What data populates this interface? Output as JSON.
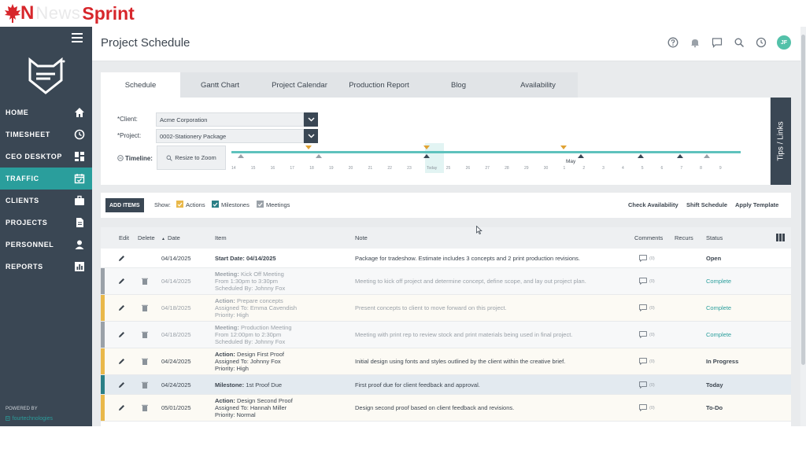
{
  "brand": {
    "n": "N",
    "news": "News",
    "sprint": "Sprint"
  },
  "sidebar": {
    "items": [
      {
        "label": "HOME",
        "icon": "home-icon"
      },
      {
        "label": "TIMESHEET",
        "icon": "clock-icon"
      },
      {
        "label": "CEO DESKTOP",
        "icon": "dashboard-icon"
      },
      {
        "label": "TRAFFIC",
        "icon": "calendar-check-icon",
        "active": true
      },
      {
        "label": "CLIENTS",
        "icon": "briefcase-icon"
      },
      {
        "label": "PROJECTS",
        "icon": "document-icon"
      },
      {
        "label": "PERSONNEL",
        "icon": "person-icon"
      },
      {
        "label": "REPORTS",
        "icon": "bar-chart-icon"
      }
    ],
    "powered_by": "POWERED BY",
    "powered_brand": "fourtechnologies"
  },
  "header": {
    "title": "Project Schedule",
    "avatar_initials": "JF"
  },
  "tabs": [
    "Schedule",
    "Gantt Chart",
    "Project Calendar",
    "Production Report",
    "Blog",
    "Availability"
  ],
  "filters": {
    "client_label": "*Client:",
    "client_value": "Acme Corporation",
    "project_label": "*Project:",
    "project_value": "0002-Stationery Package",
    "timeline_label": "Timeline:",
    "resize_label": "Resize to Zoom",
    "month_label": "May",
    "ticks": [
      "14",
      "15",
      "16",
      "17",
      "18",
      "19",
      "20",
      "21",
      "22",
      "23",
      "Today",
      "25",
      "26",
      "27",
      "28",
      "29",
      "30",
      "1",
      "2",
      "3",
      "4",
      "5",
      "6",
      "7",
      "8",
      "9"
    ],
    "tips_label": "Tips / Links"
  },
  "actionbar": {
    "add_items": "ADD ITEMS",
    "show_label": "Show:",
    "actions": "Actions",
    "milestones": "Milestones",
    "meetings": "Meetings",
    "check_availability": "Check Availability",
    "shift_schedule": "Shift Schedule",
    "apply_template": "Apply Template"
  },
  "table": {
    "headers": {
      "edit": "Edit",
      "delete": "Delete",
      "date": "Date",
      "item": "Item",
      "note": "Note",
      "comments": "Comments",
      "recurs": "Recurs",
      "status": "Status"
    },
    "rows": [
      {
        "date": "04/14/2025",
        "item_title": "Start Date: 04/14/2025",
        "item_lines": [],
        "note": "Package for tradeshow. Estimate includes 3 concepts and 2 print production revisions.",
        "comments": "(0)",
        "status": "Open",
        "stripe": "",
        "muted": false,
        "status_class": "bold",
        "title_bold": true,
        "title_prefix": "",
        "delete": false
      },
      {
        "date": "04/14/2025",
        "title_prefix": "Meeting:",
        "item_title": "Kick Off Meeting",
        "item_lines": [
          "From 1:30pm to 3:30pm",
          "Scheduled By: Johnny Fox"
        ],
        "note": "Meeting to kick off project and determine concept, define scope, and lay out project plan.",
        "comments": "(0)",
        "status": "Complete",
        "stripe": "#9aa1a8",
        "muted": true,
        "status_class": "status-complete",
        "delete": true
      },
      {
        "date": "04/18/2025",
        "title_prefix": "Action:",
        "item_title": "Prepare concepts",
        "item_lines": [
          "Assigned To: Emma Cavendish",
          "Priority: High"
        ],
        "note": "Present concepts to client to move forward on this project.",
        "comments": "(0)",
        "status": "Complete",
        "stripe": "#e9b84a",
        "muted": true,
        "status_class": "status-complete",
        "delete": true
      },
      {
        "date": "04/18/2025",
        "title_prefix": "Meeting:",
        "item_title": "Production Meeting",
        "item_lines": [
          "From 12:00pm to 2:30pm",
          "Scheduled By: Johnny Fox"
        ],
        "note": "Meeting with print rep to review stock and print materials being used in final project.",
        "comments": "(0)",
        "status": "Complete",
        "stripe": "#9aa1a8",
        "muted": true,
        "status_class": "status-complete",
        "delete": true
      },
      {
        "date": "04/24/2025",
        "title_prefix": "Action:",
        "item_title": "Design First Proof",
        "item_lines": [
          "Assigned To: Johnny Fox",
          "Priority: High"
        ],
        "note": "Initial design using fonts and styles outlined by the client within the creative brief.",
        "comments": "(0)",
        "status": "In Progress",
        "stripe": "#e9b84a",
        "muted": false,
        "status_class": "bold",
        "delete": true
      },
      {
        "date": "04/24/2025",
        "title_prefix": "Milestone:",
        "item_title": "1st Proof Due",
        "item_lines": [],
        "note": "First proof due for client feedback and approval.",
        "comments": "(0)",
        "status": "Today",
        "stripe": "#2a7f86",
        "muted": false,
        "status_class": "bold",
        "delete": true
      },
      {
        "date": "05/01/2025",
        "title_prefix": "Action:",
        "item_title": "Design Second Proof",
        "item_lines": [
          "Assigned To: Hannah Miller",
          "Priority: Normal"
        ],
        "note": "Design second proof based on client feedback and revisions.",
        "comments": "(0)",
        "status": "To-Do",
        "stripe": "#e9b84a",
        "muted": false,
        "status_class": "bold",
        "delete": true
      }
    ]
  }
}
